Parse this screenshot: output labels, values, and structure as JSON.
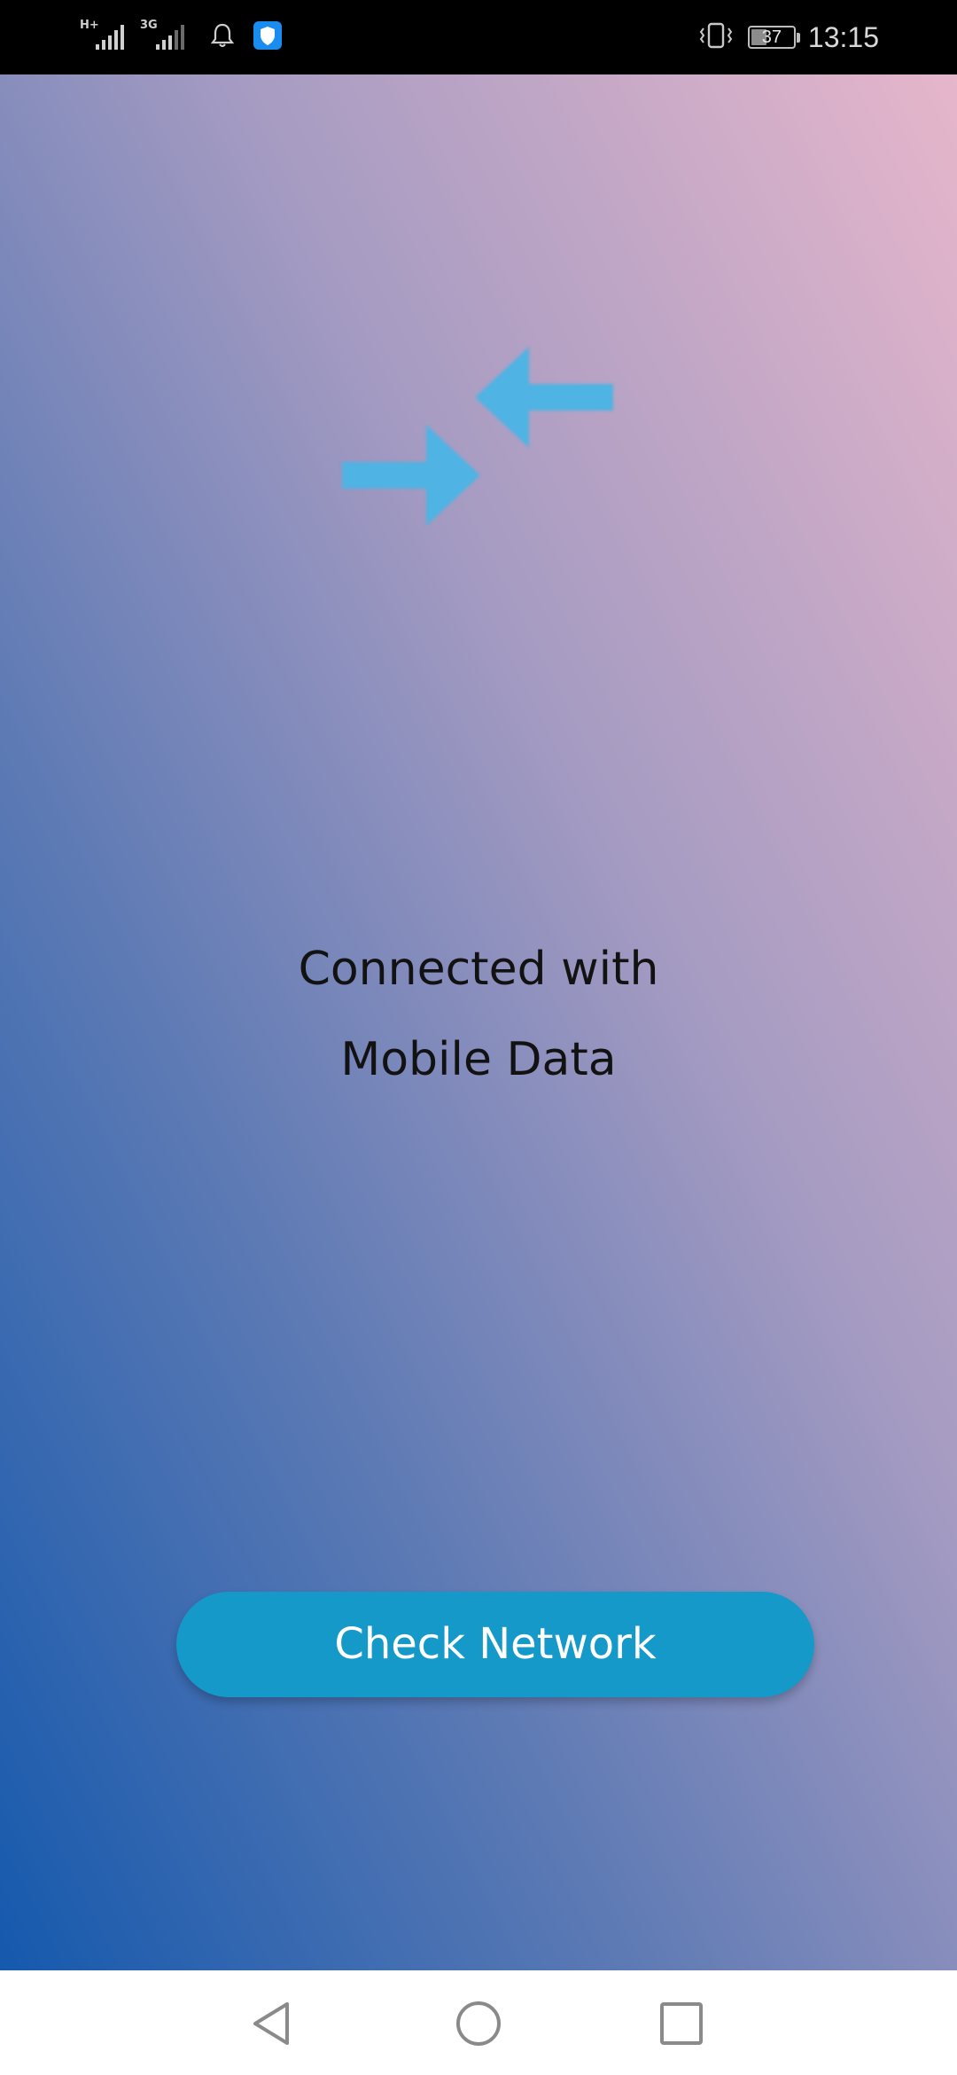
{
  "status_bar": {
    "signal_1": {
      "type": "H+",
      "icon": "signal-strength-icon"
    },
    "signal_2": {
      "type": "3G",
      "icon": "signal-strength-icon"
    },
    "notification_icon": "bell-icon",
    "app_icon": "shield-icon",
    "vibrate_icon": "vibrate-icon",
    "battery_level": "37",
    "time": "13:15"
  },
  "main": {
    "icon": "data-transfer-arrows-icon",
    "icon_color": "#4fb3e3",
    "status_line_1": "Connected with",
    "status_line_2": "Mobile Data",
    "button_label": "Check Network",
    "button_color": "#1599c9"
  },
  "nav_bar": {
    "back_icon": "back-triangle-icon",
    "home_icon": "home-circle-icon",
    "recents_icon": "recents-square-icon"
  }
}
